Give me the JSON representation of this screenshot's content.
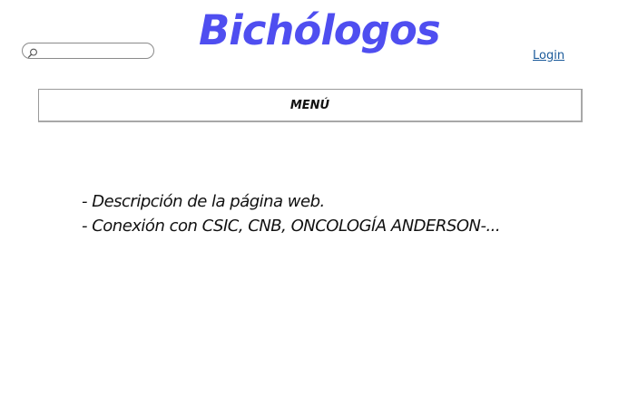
{
  "header": {
    "title": "Bichólogos",
    "login_label": "Login",
    "search": {
      "value": "",
      "placeholder": "",
      "icon": "search-icon"
    }
  },
  "menu": {
    "label": "MENÚ"
  },
  "content": {
    "lines": [
      "- Descripción de la página web.",
      "- Conexión con CSIC, CNB, ONCOLOGÍA ANDERSON-..."
    ]
  },
  "colors": {
    "title": "#4f4ef0",
    "link": "#1a5a9a",
    "menu_border": "#9a9a9a"
  }
}
